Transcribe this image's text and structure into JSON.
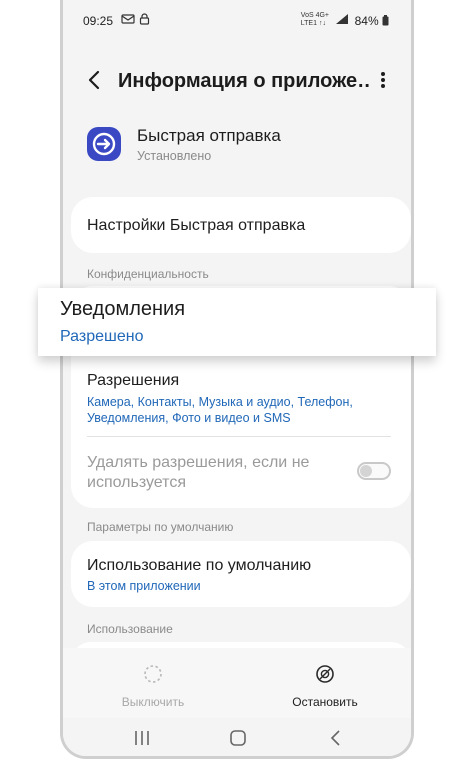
{
  "status_bar": {
    "time": "09:25",
    "network_top": "VoS 4G+",
    "network_bottom": "LTE1 ↑↓",
    "battery": "84%"
  },
  "app_bar": {
    "title": "Информация о приложе…"
  },
  "app": {
    "name": "Быстрая отправка",
    "status": "Установлено",
    "accent": "#3a48c4"
  },
  "settings_row": {
    "label": "Настройки Быстрая отправка"
  },
  "privacy": {
    "section_label": "Конфиденциальность",
    "notifications": {
      "label": "Уведомления",
      "value": "Разрешено"
    },
    "permissions": {
      "label": "Разрешения",
      "value_line1": "Камера, Контакты, Музыка и аудио, Телефон,",
      "value_line2": "Уведомления, Фото и видео и SMS"
    },
    "remove_permissions": {
      "label_line1": "Удалять разрешения, если не",
      "label_line2": "используется",
      "enabled": false
    }
  },
  "defaults": {
    "section_label": "Параметры по умолчанию",
    "default_use": {
      "label": "Использование по умолчанию",
      "value": "В этом приложении"
    }
  },
  "usage": {
    "section_label": "Использование"
  },
  "actions": {
    "disable_label": "Выключить",
    "stop_label": "Остановить"
  },
  "colors": {
    "link_blue": "#2168b8",
    "background": "#f4f4f4"
  }
}
